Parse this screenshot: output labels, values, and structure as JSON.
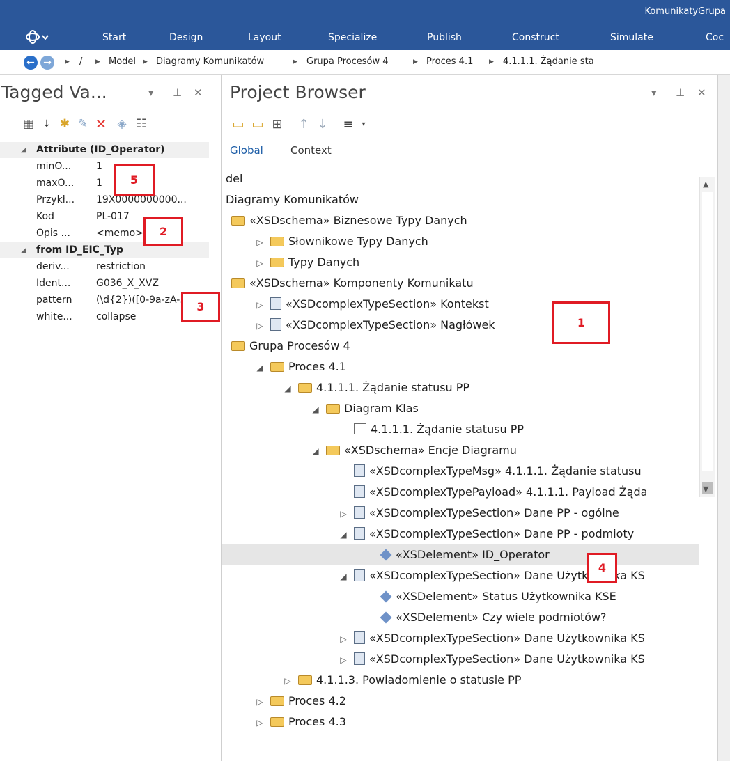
{
  "app_title": "KomunikatyGrupa",
  "ribbon": {
    "tabs": [
      "Start",
      "Design",
      "Layout",
      "Specialize",
      "Publish",
      "Construct",
      "Simulate",
      "Coc"
    ]
  },
  "breadcrumb": {
    "root": "/",
    "items": [
      "Model",
      "Diagramy Komunikatów",
      "Grupa Procesów 4",
      "Proces 4.1",
      "4.1.1.1. Żądanie sta"
    ]
  },
  "tagged_values": {
    "title": "Tagged Va...",
    "categories": [
      {
        "label": "Attribute (ID_Operator)",
        "rows": [
          {
            "key": "minO...",
            "value": "1"
          },
          {
            "key": "maxO...",
            "value": "1"
          },
          {
            "key": "Przykł...",
            "value": "19X0000000000..."
          },
          {
            "key": "Kod",
            "value": "PL-017"
          },
          {
            "key": "Opis ...",
            "value": "<memo>*"
          }
        ]
      },
      {
        "label": "from ID_EIC_Typ",
        "rows": [
          {
            "key": "deriv...",
            "value": "restriction"
          },
          {
            "key": "Ident...",
            "value": "G036_X_XVZ"
          },
          {
            "key": "pattern",
            "value": "(\\d{2})([0-9a-zA-..."
          },
          {
            "key": "white...",
            "value": "collapse"
          }
        ]
      }
    ]
  },
  "project_browser": {
    "title": "Project Browser",
    "subtabs": [
      "Global",
      "Context"
    ],
    "tree": [
      {
        "label": "del",
        "indent": 0,
        "icon": "none",
        "expander": "none"
      },
      {
        "label": "Diagramy Komunikatów",
        "indent": 0,
        "icon": "none",
        "expander": "none"
      },
      {
        "label": "«XSDschema» Biznesowe Typy Danych",
        "indent": 0,
        "icon": "folder",
        "expander": "none"
      },
      {
        "label": "Słownikowe Typy Danych",
        "indent": 1,
        "icon": "folder",
        "expander": "collapsed"
      },
      {
        "label": "Typy Danych",
        "indent": 1,
        "icon": "folder",
        "expander": "collapsed"
      },
      {
        "label": "«XSDschema» Komponenty Komunikatu",
        "indent": 0,
        "icon": "folder",
        "expander": "none"
      },
      {
        "label": "«XSDcomplexTypeSection» Kontekst",
        "indent": 1,
        "icon": "doc",
        "expander": "collapsed"
      },
      {
        "label": "«XSDcomplexTypeSection» Nagłówek",
        "indent": 1,
        "icon": "doc",
        "expander": "collapsed"
      },
      {
        "label": "Grupa Procesów 4",
        "indent": 0,
        "icon": "folder",
        "expander": "none"
      },
      {
        "label": "Proces 4.1",
        "indent": 1,
        "icon": "folder",
        "expander": "expanded"
      },
      {
        "label": "4.1.1.1. Żądanie statusu PP",
        "indent": 2,
        "icon": "folder",
        "expander": "expanded"
      },
      {
        "label": "Diagram Klas",
        "indent": 3,
        "icon": "folder",
        "expander": "expanded"
      },
      {
        "label": "4.1.1.1. Żądanie statusu PP",
        "indent": 4,
        "icon": "diagram",
        "expander": "none"
      },
      {
        "label": "«XSDschema» Encje Diagramu",
        "indent": 3,
        "icon": "folder",
        "expander": "expanded"
      },
      {
        "label": "«XSDcomplexTypeMsg» 4.1.1.1. Żądanie statusu",
        "indent": 4,
        "icon": "doc",
        "expander": "none"
      },
      {
        "label": "«XSDcomplexTypePayload» 4.1.1.1. Payload Żąda",
        "indent": 4,
        "icon": "doc",
        "expander": "none"
      },
      {
        "label": "«XSDcomplexTypeSection» Dane PP - ogólne",
        "indent": 4,
        "icon": "doc",
        "expander": "collapsed"
      },
      {
        "label": "«XSDcomplexTypeSection» Dane PP - podmioty",
        "indent": 4,
        "icon": "doc",
        "expander": "expanded"
      },
      {
        "label": "«XSDelement» ID_Operator",
        "indent": 5,
        "icon": "element",
        "expander": "none",
        "selected": true
      },
      {
        "label": "«XSDcomplexTypeSection» Dane Użytkownika KS",
        "indent": 4,
        "icon": "doc",
        "expander": "expanded"
      },
      {
        "label": "«XSDelement» Status Użytkownika KSE",
        "indent": 5,
        "icon": "element",
        "expander": "none"
      },
      {
        "label": "«XSDelement» Czy wiele podmiotów?",
        "indent": 5,
        "icon": "element",
        "expander": "none"
      },
      {
        "label": "«XSDcomplexTypeSection» Dane Użytkownika KS",
        "indent": 4,
        "icon": "doc",
        "expander": "collapsed"
      },
      {
        "label": "«XSDcomplexTypeSection» Dane Użytkownika KS",
        "indent": 4,
        "icon": "doc",
        "expander": "collapsed"
      },
      {
        "label": "4.1.1.3. Powiadomienie o statusie PP",
        "indent": 2,
        "icon": "folder",
        "expander": "collapsed"
      },
      {
        "label": "Proces 4.2",
        "indent": 1,
        "icon": "folder",
        "expander": "collapsed"
      },
      {
        "label": "Proces 4.3",
        "indent": 1,
        "icon": "folder",
        "expander": "collapsed"
      }
    ]
  },
  "annotations": [
    "1",
    "2",
    "3",
    "4",
    "5"
  ],
  "colors": {
    "ribbon": "#2b579a",
    "annotation": "#e01b24",
    "selection": "#e6e6e6"
  }
}
